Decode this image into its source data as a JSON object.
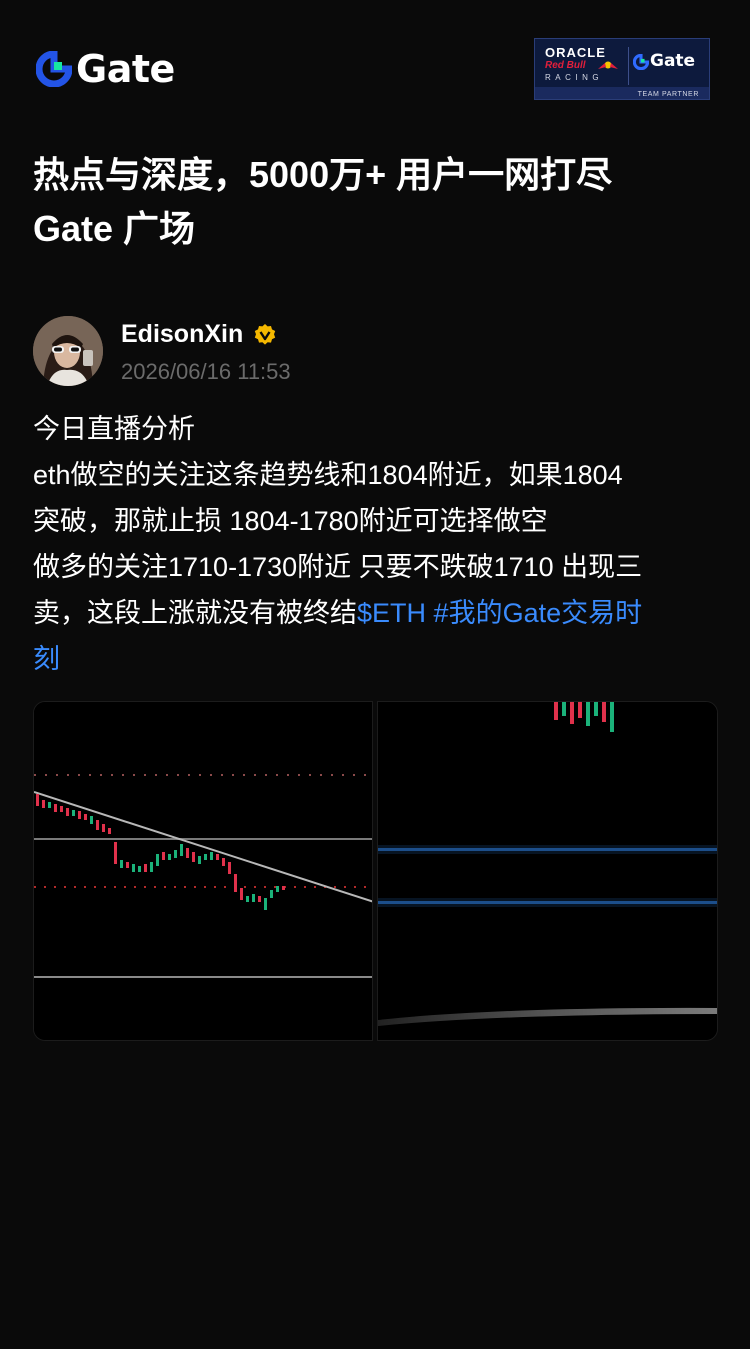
{
  "header": {
    "logo_text": "Gate",
    "partner": {
      "oracle": "ORACLE",
      "redbull": "Red Bull",
      "racing": "RACING",
      "gate": "Gate",
      "team_partner": "TEAM PARTNER"
    }
  },
  "hero": {
    "title_line1": "热点与深度，5000万+ 用户一网打尽",
    "title_line2": "Gate 广场"
  },
  "post": {
    "author": "EdisonXin",
    "verified": true,
    "timestamp": "2026/06/16 11:53",
    "lines": [
      "今日直播分析",
      "eth做空的关注这条趋势线和1804附近，如果1804",
      "突破，那就止损  1804-1780附近可选择做空",
      "做多的关注1710-1730附近 只要不跌破1710 出现三",
      "卖，这段上涨就没有被终结"
    ],
    "tag_cashtag": "$ETH",
    "tag_hashtag_a": "#我的Gate交易时",
    "tag_hashtag_b": "刻",
    "images": [
      {
        "name": "chart-screenshot-1"
      },
      {
        "name": "chart-screenshot-2"
      }
    ]
  },
  "colors": {
    "background": "#0a0a0a",
    "brand_blue": "#2354e6",
    "brand_green": "#17e6a1",
    "hashtag": "#3a8bfd",
    "verified_gold": "#f5b800",
    "muted_text": "#6b6b6b"
  },
  "icons": {
    "logo": "gate-logo-icon",
    "verified": "verified-badge-icon"
  }
}
